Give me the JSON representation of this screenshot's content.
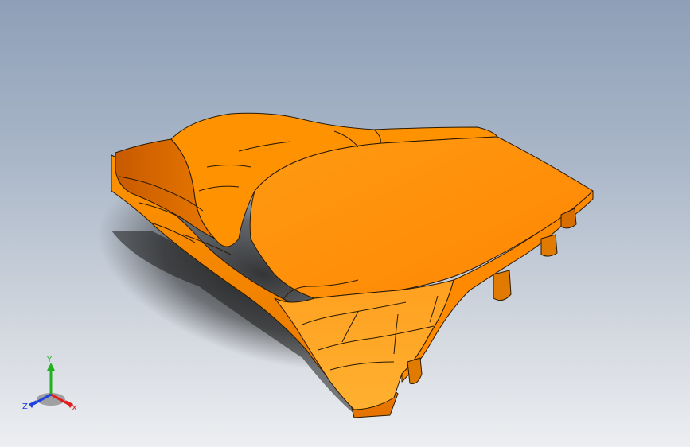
{
  "viewport": {
    "background_top": "#8e9fb7",
    "background_bottom": "#eceef1"
  },
  "model": {
    "name": "motorcycle-seat-part",
    "color": "#ff8c00",
    "edge_color": "#2a1a00"
  },
  "triad": {
    "y_label": "Y",
    "x_label": "X",
    "z_label": "Z",
    "x_color": "#e02020",
    "y_color": "#20b020",
    "z_color": "#2040e0"
  }
}
